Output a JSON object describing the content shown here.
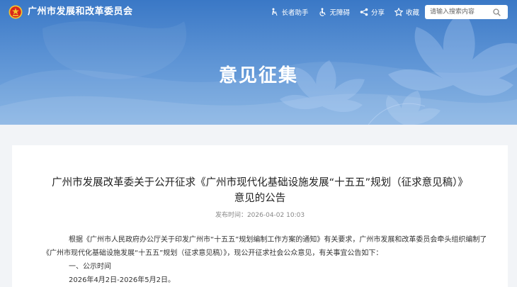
{
  "header": {
    "site_title": "广州市发展和改革委员会",
    "tools": [
      {
        "label": "长者助手",
        "icon": "elderly-icon"
      },
      {
        "label": "无障碍",
        "icon": "accessibility-icon"
      },
      {
        "label": "分享",
        "icon": "share-icon"
      },
      {
        "label": "收藏",
        "icon": "star-icon"
      }
    ],
    "search": {
      "placeholder": "请输入搜索内容"
    }
  },
  "banner": {
    "title": "意见征集"
  },
  "article": {
    "title_line1": "广州市发展改革委关于公开征求《广州市现代化基础设施发展“十五五”规划（征求意见稿）》",
    "title_line2": "意见的公告",
    "publish_label": "发布时间：",
    "publish_time": "2026-04-02 10:03",
    "paragraphs": [
      "根据《广州市人民政府办公厅关于印发广州市“十五五”规划编制工作方案的通知》有关要求，广州市发展和改革委员会牵头组织编制了",
      "《广州市现代化基础设施发展“十五五”规划（征求意见稿）》，现公开征求社会公众意见，有关事宜公告如下：",
      "一、公示时间",
      "2026年4月2日-2026年5月2日。"
    ]
  },
  "colors": {
    "banner_blue": "#3a78c6",
    "emblem_red": "#d9261c",
    "emblem_gold": "#f4c430"
  }
}
